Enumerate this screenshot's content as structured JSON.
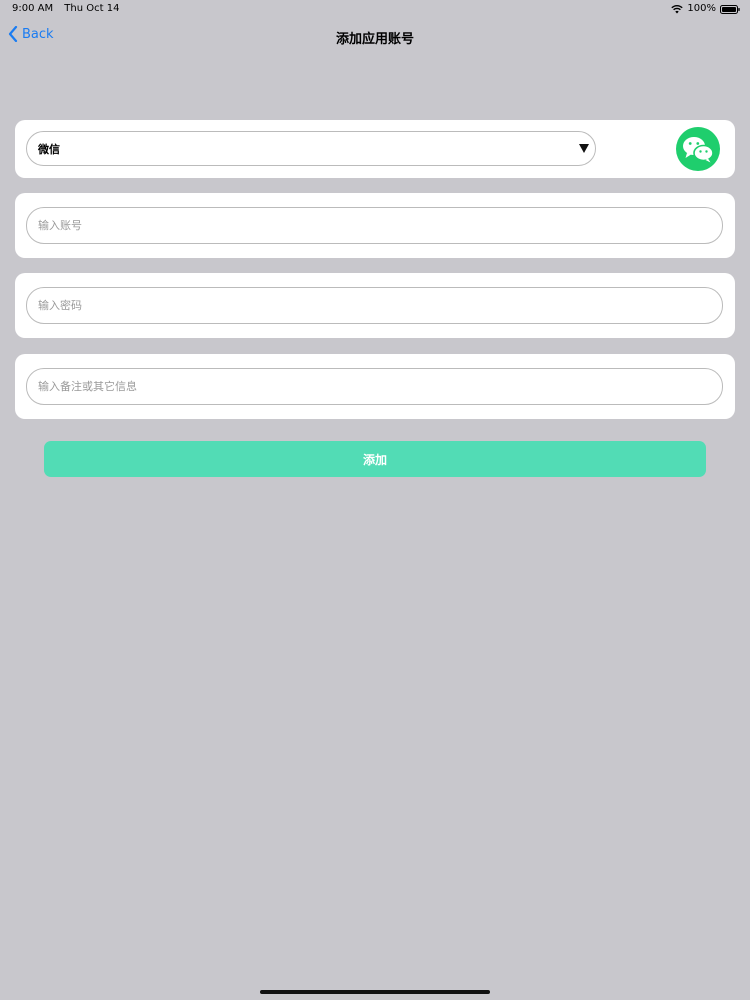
{
  "status_bar": {
    "time": "9:00 AM",
    "date": "Thu Oct 14",
    "battery": "100%"
  },
  "nav": {
    "back_label": "Back",
    "title": "添加应用账号"
  },
  "app_picker": {
    "selected": "微信",
    "logo_icon": "wechat-icon",
    "logo_color": "#1fce6d"
  },
  "form": {
    "account_placeholder": "输入账号",
    "password_placeholder": "输入密码",
    "note_placeholder": "输入备注或其它信息"
  },
  "actions": {
    "add_label": "添加",
    "add_color": "#52dcb5"
  },
  "colors": {
    "background": "#c8c7cc",
    "accent": "#1a7cf2"
  }
}
